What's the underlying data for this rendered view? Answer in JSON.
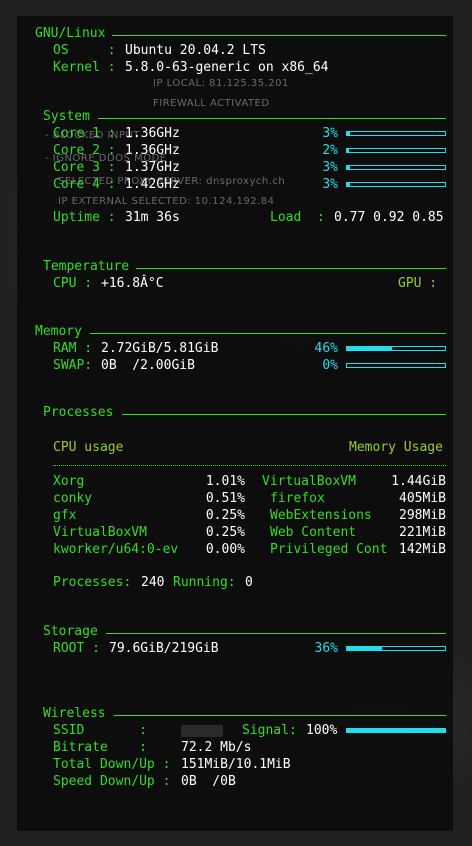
{
  "gnu": {
    "header": "GNU/Linux",
    "os_label": "OS     :",
    "os_value": "Ubuntu 20.04.2 LTS",
    "kernel_label": "Kernel :",
    "kernel_value": "5.8.0-63-generic on x86_64"
  },
  "wallpaper": {
    "ip_local": "IP LOCAL: 81.125.35.201",
    "firewall": "FIREWALL ACTIVATED",
    "blocked": "- BLOCKED INPUT",
    "ignore": "- IGNORE DDOS MODE",
    "proxy": "SELECTED PROXY SERVER: dnsproxych.ch",
    "ip_external": "IP EXTERNAL SELECTED: 10.124.192.84"
  },
  "system": {
    "header": "System",
    "cores": [
      {
        "label": "Core 1 :",
        "freq": "1.36GHz",
        "pct_text": "3%",
        "pct": 3
      },
      {
        "label": "Core 2 :",
        "freq": "1.36GHz",
        "pct_text": "2%",
        "pct": 2
      },
      {
        "label": "Core 3 :",
        "freq": "1.37GHz",
        "pct_text": "3%",
        "pct": 3
      },
      {
        "label": "Core 4 :",
        "freq": "1.42GHz",
        "pct_text": "3%",
        "pct": 3
      }
    ],
    "uptime_label": "Uptime :",
    "uptime_value": "31m 36s",
    "load_label": "Load  :",
    "load_value": "0.77 0.92 0.85"
  },
  "temperature": {
    "header": "Temperature",
    "cpu_label": "CPU :",
    "cpu_value": "+16.8Â°C",
    "gpu_label": "GPU :"
  },
  "memory": {
    "header": "Memory",
    "ram_label": "RAM :",
    "ram_value": "2.72GiB/5.81GiB",
    "ram_pct_text": "46%",
    "ram_pct": 46,
    "swap_label": "SWAP:",
    "swap_value": "0B  /2.00GiB",
    "swap_pct_text": "0%",
    "swap_pct": 0
  },
  "processes": {
    "header": "Processes",
    "cpu_header": "CPU usage",
    "mem_header": "Memory Usage",
    "cpu_list": [
      {
        "name": "Xorg",
        "value": "1.01%"
      },
      {
        "name": "conky",
        "value": "0.51%"
      },
      {
        "name": "gfx",
        "value": "0.25%"
      },
      {
        "name": "VirtualBoxVM",
        "value": "0.25%"
      },
      {
        "name": "kworker/u64:0-ev",
        "value": "0.00%"
      }
    ],
    "mem_list": [
      {
        "name": "VirtualBoxVM",
        "value": "1.44GiB"
      },
      {
        "name": "firefox",
        "value": "405MiB"
      },
      {
        "name": "WebExtensions",
        "value": "298MiB"
      },
      {
        "name": "Web Content",
        "value": "221MiB"
      },
      {
        "name": "Privileged Cont",
        "value": "142MiB"
      }
    ],
    "summary_label": "Processes:",
    "summary_count": "240",
    "running_label": "Running:",
    "running_count": "0"
  },
  "storage": {
    "header": "Storage",
    "root_label": "ROOT :",
    "root_value": "79.6GiB/219GiB",
    "root_pct_text": "36%",
    "root_pct": 36
  },
  "wireless": {
    "header": "Wireless",
    "ssid_label": "SSID       :",
    "signal_label": "Signal:",
    "signal_value": "100%",
    "signal_pct": 100,
    "bitrate_label": "Bitrate    :",
    "bitrate_value": "72.2 Mb/s",
    "total_label": "Total Down/Up :",
    "total_value": "151MiB/10.1MiB",
    "speed_label": "Speed Down/Up :",
    "speed_value": "0B  /0B"
  },
  "colors": {
    "accent_green": "#33dd22",
    "accent_cyan": "#22ddee",
    "accent_yellow": "#99cc33",
    "text": "#ffffff"
  }
}
